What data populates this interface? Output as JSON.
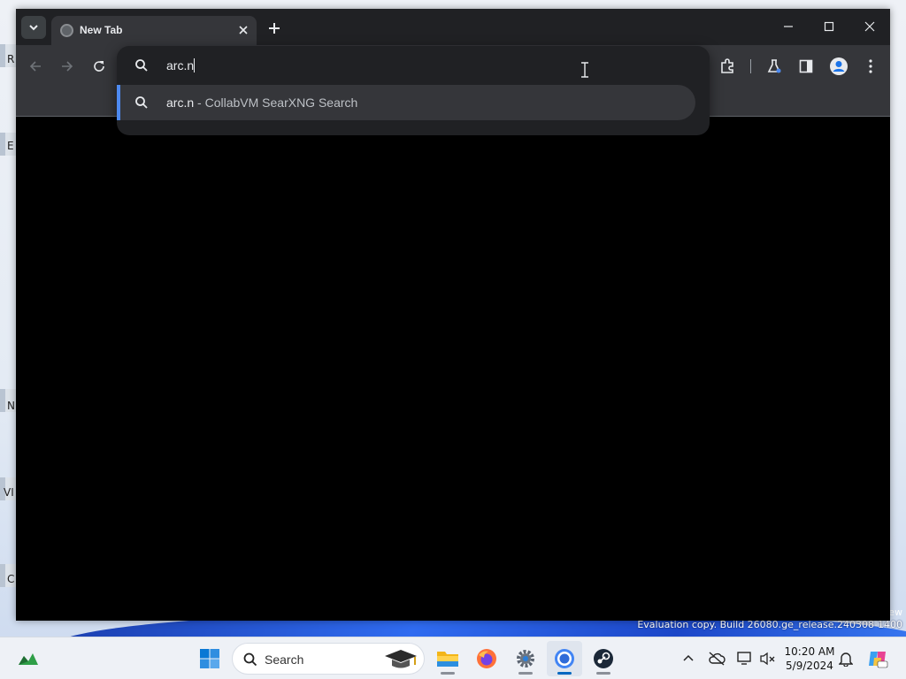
{
  "browser": {
    "tab": {
      "title": "New Tab",
      "close_icon": "close-icon",
      "favicon": "globe-icon"
    },
    "tab_search_icon": "chevron-down-icon",
    "new_tab_icon": "plus-icon",
    "window_controls": {
      "minimize": "minimize-icon",
      "maximize": "maximize-icon",
      "close": "close-icon"
    },
    "toolbar": {
      "back_icon": "arrow-left-icon",
      "forward_icon": "arrow-right-icon",
      "reload_icon": "reload-icon",
      "extensions_icon": "puzzle-icon",
      "labs_icon": "flask-icon",
      "side_panel_icon": "side-panel-icon",
      "profile_icon": "profile-icon",
      "menu_icon": "more-vertical-icon"
    },
    "omnibox": {
      "input_value": "arc.n",
      "suggestions": [
        {
          "query": "arc.n",
          "separator": "-",
          "description": "CollabVM SearXNG Search",
          "icon": "search-icon"
        }
      ]
    }
  },
  "desktop": {
    "watermark": "Evaluation copy. Build 26080.ge_release.240308-1400",
    "watermark_top": "ew",
    "edge_letters": [
      "R",
      "E",
      "N",
      "VI",
      "C"
    ]
  },
  "taskbar": {
    "search_label": "Search",
    "clock_time": "10:20 AM",
    "clock_date": "5/9/2024",
    "apps": [
      "widgets-icon",
      "start-icon",
      "file-explorer-icon",
      "firefox-icon",
      "settings-icon",
      "chrome-icon",
      "steam-icon"
    ],
    "tray": [
      "chevron-up-icon",
      "cloud-off-icon",
      "network-icon",
      "volume-muted-icon",
      "bell-icon",
      "copilot-icon"
    ]
  },
  "colors": {
    "accent": "#4d8af0",
    "titlebar": "#202124",
    "toolbar": "#35363a"
  }
}
